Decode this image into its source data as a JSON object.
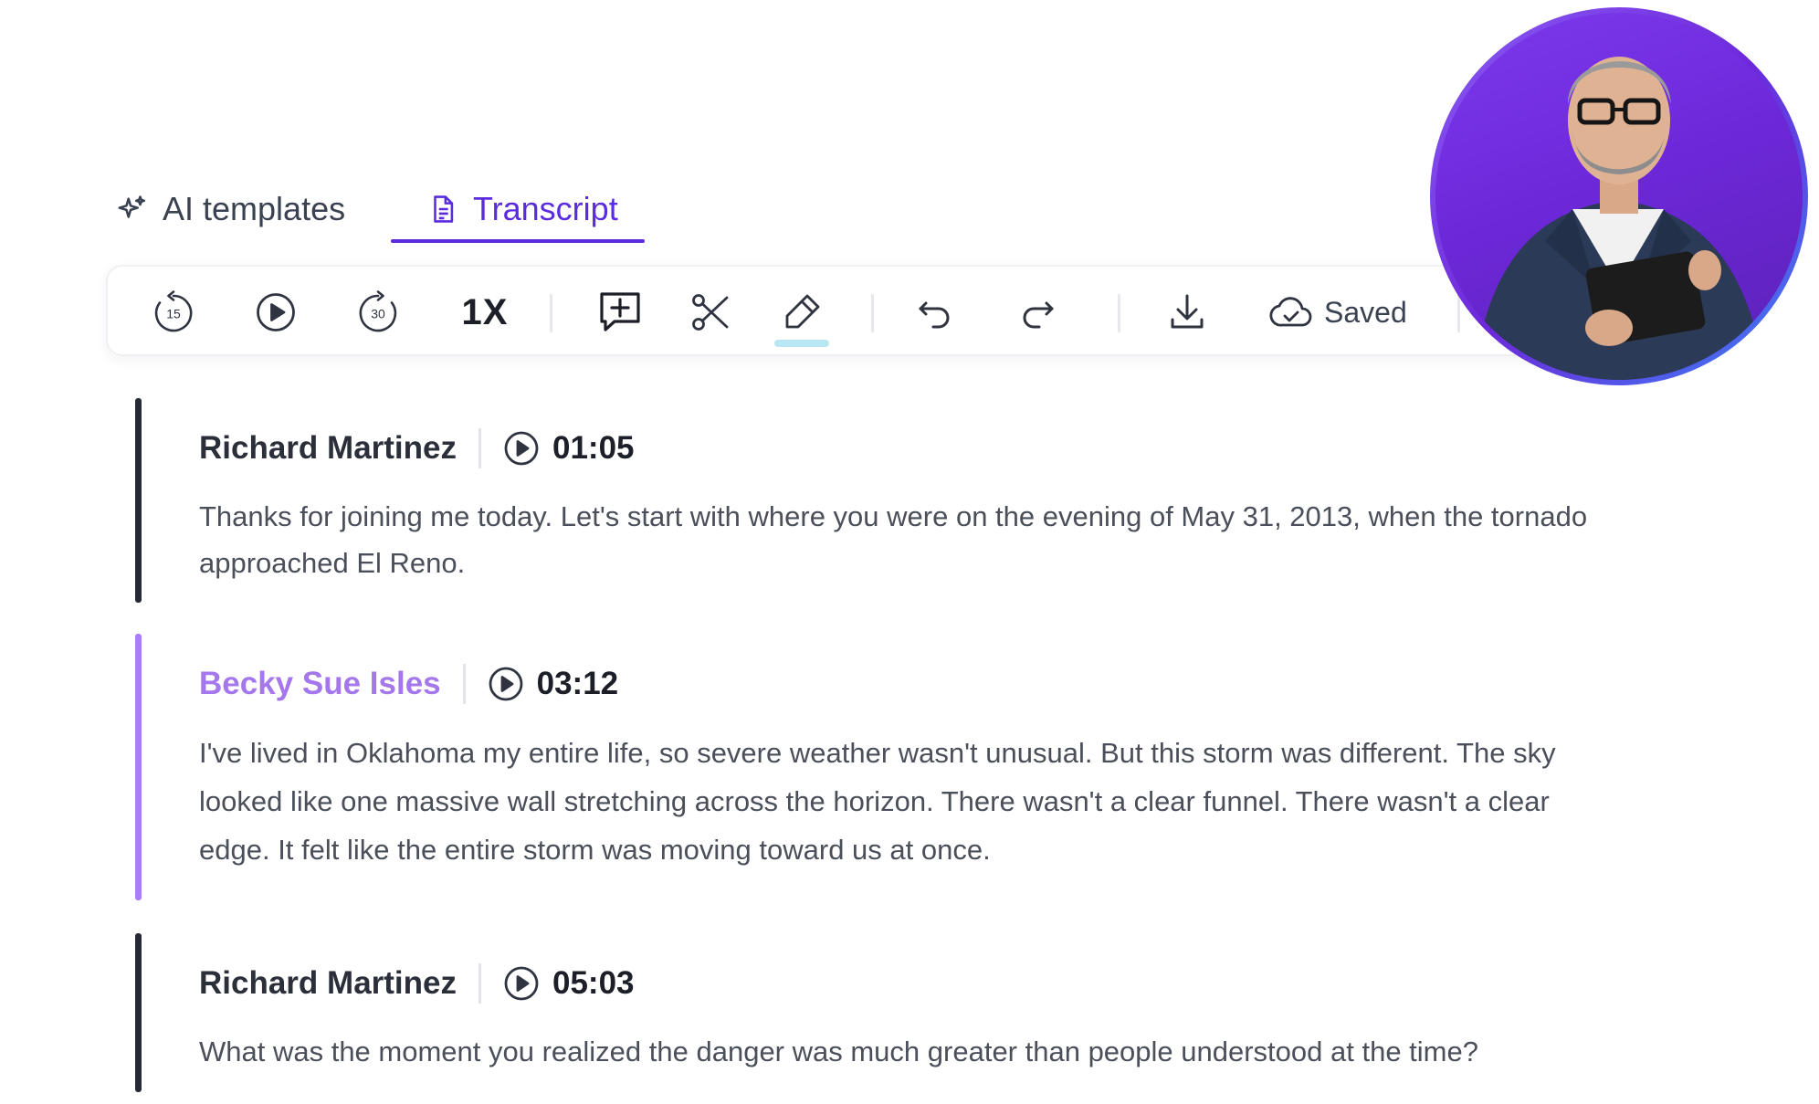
{
  "tabs": {
    "ai_templates": "AI templates",
    "transcript": "Transcript"
  },
  "toolbar": {
    "rewind_label": "15",
    "forward_label": "30",
    "speed": "1X",
    "saved": "Saved"
  },
  "colors": {
    "accent": "#5b2be0",
    "speaker_highlight": "#a577ec",
    "highlighter": "#b8e6f2"
  },
  "icons": [
    "sparkle-icon",
    "document-icon",
    "rewind-15-icon",
    "play-icon",
    "forward-30-icon",
    "add-comment-icon",
    "scissors-icon",
    "highlighter-icon",
    "undo-icon",
    "redo-icon",
    "download-icon",
    "cloud-check-icon",
    "play-circle-icon"
  ],
  "transcript": {
    "segments": [
      {
        "speaker": "Richard Martinez",
        "time": "01:05",
        "text": "Thanks for joining me today. Let's start with where you were on the evening of May 31, 2013, when the tornado approached El Reno."
      },
      {
        "speaker": "Becky Sue Isles",
        "time": "03:12",
        "text": "I've lived in Oklahoma my entire life, so severe weather wasn't unusual. But this storm was different. The sky looked like one massive wall stretching across the horizon. There wasn't a clear funnel. There wasn't a clear edge. It felt like the entire storm was moving toward us at once."
      },
      {
        "speaker": "Richard Martinez",
        "time": "05:03",
        "text": "What was the moment you realized the danger was much greater than people understood at the time?"
      }
    ]
  }
}
